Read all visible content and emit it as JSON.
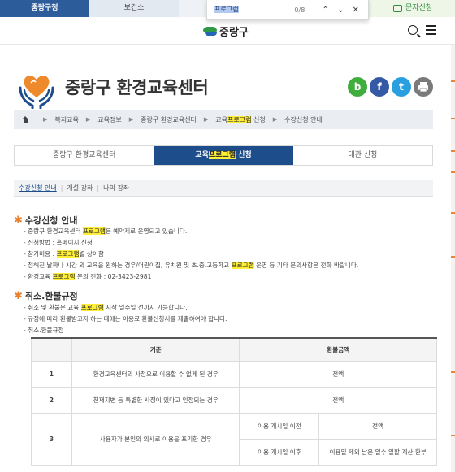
{
  "top_tabs": [
    "중랑구청",
    "보건소"
  ],
  "text_message_label": "문자신청",
  "find": {
    "query": "프로그램",
    "count": "0/8"
  },
  "logo_text": "중랑구",
  "page_title": "중랑구 환경교육센터",
  "share": {
    "blog": "b",
    "facebook": "f",
    "twitter": "t"
  },
  "breadcrumb": [
    "복지교육",
    "교육정보",
    "중랑구 환경교육센터",
    "교육",
    "프로그램",
    " 신청",
    "수강신청 안내"
  ],
  "tabs": {
    "t1": "중랑구 환경교육센터",
    "t2_pre": "교육",
    "t2_hl": "프로그램",
    "t2_post": " 신청",
    "t3": "대관 신청"
  },
  "subtabs": [
    "수강신청 안내",
    "개설 강좌",
    "나의 강좌"
  ],
  "sections": {
    "s1_title": "수강신청 안내",
    "s1": {
      "l1a": "- 중랑구 환경교육센터 ",
      "l1h": "프로그램",
      "l1b": "은 예약제로 운영되고 있습니다.",
      "l2": "- 신청방법 : 홈페이지 신청",
      "l3a": "- 참가비용 : ",
      "l3h": "프로그램",
      "l3b": "별 상이함",
      "l4a": "- 정해진 날짜나 시간 외 교육을 원하는 경우/어린이집, 유치원 및 초.중.고등학교 ",
      "l4h": "프로그램",
      "l4b": " 운영 등 기타 문의사항은 전화 바랍니다.",
      "l5a": "- 환경교육 ",
      "l5h": "프로그램",
      "l5b": " 문의 전화 : 02-3423-2981"
    },
    "s2_title": "취소.환불규정",
    "s2": {
      "l1a": "- 취소 및 환불은 교육 ",
      "l1h": "프로그램",
      "l1b": " 시작 일주일 전까지 가능합니다.",
      "l2": "- 규정에 따라 환불받고자 하는 때에는 이용료 환불신청서를 제출하여야 합니다.",
      "l3": "- 취소.환불규정"
    }
  },
  "refund_table": {
    "headers": [
      "기준",
      "환불금액"
    ],
    "rows": [
      {
        "no": "1",
        "criterion": "환경교육센터의 사정으로 이용할 수 없게 된 경우",
        "amount": "전액"
      },
      {
        "no": "2",
        "criterion": "천재지변 등 특별한 사정이 있다고 인정되는 경우",
        "amount": "전액"
      },
      {
        "no": "3",
        "criterion": "사용자가 본인의 의사로 이용을 포기한 경우",
        "sub": [
          {
            "when": "이용 개시일 이전",
            "amount": "전액"
          },
          {
            "when": "이용 개시일 이후",
            "amount": "이용일 제외 남은 일수 일할 계산 환부"
          }
        ]
      }
    ]
  }
}
